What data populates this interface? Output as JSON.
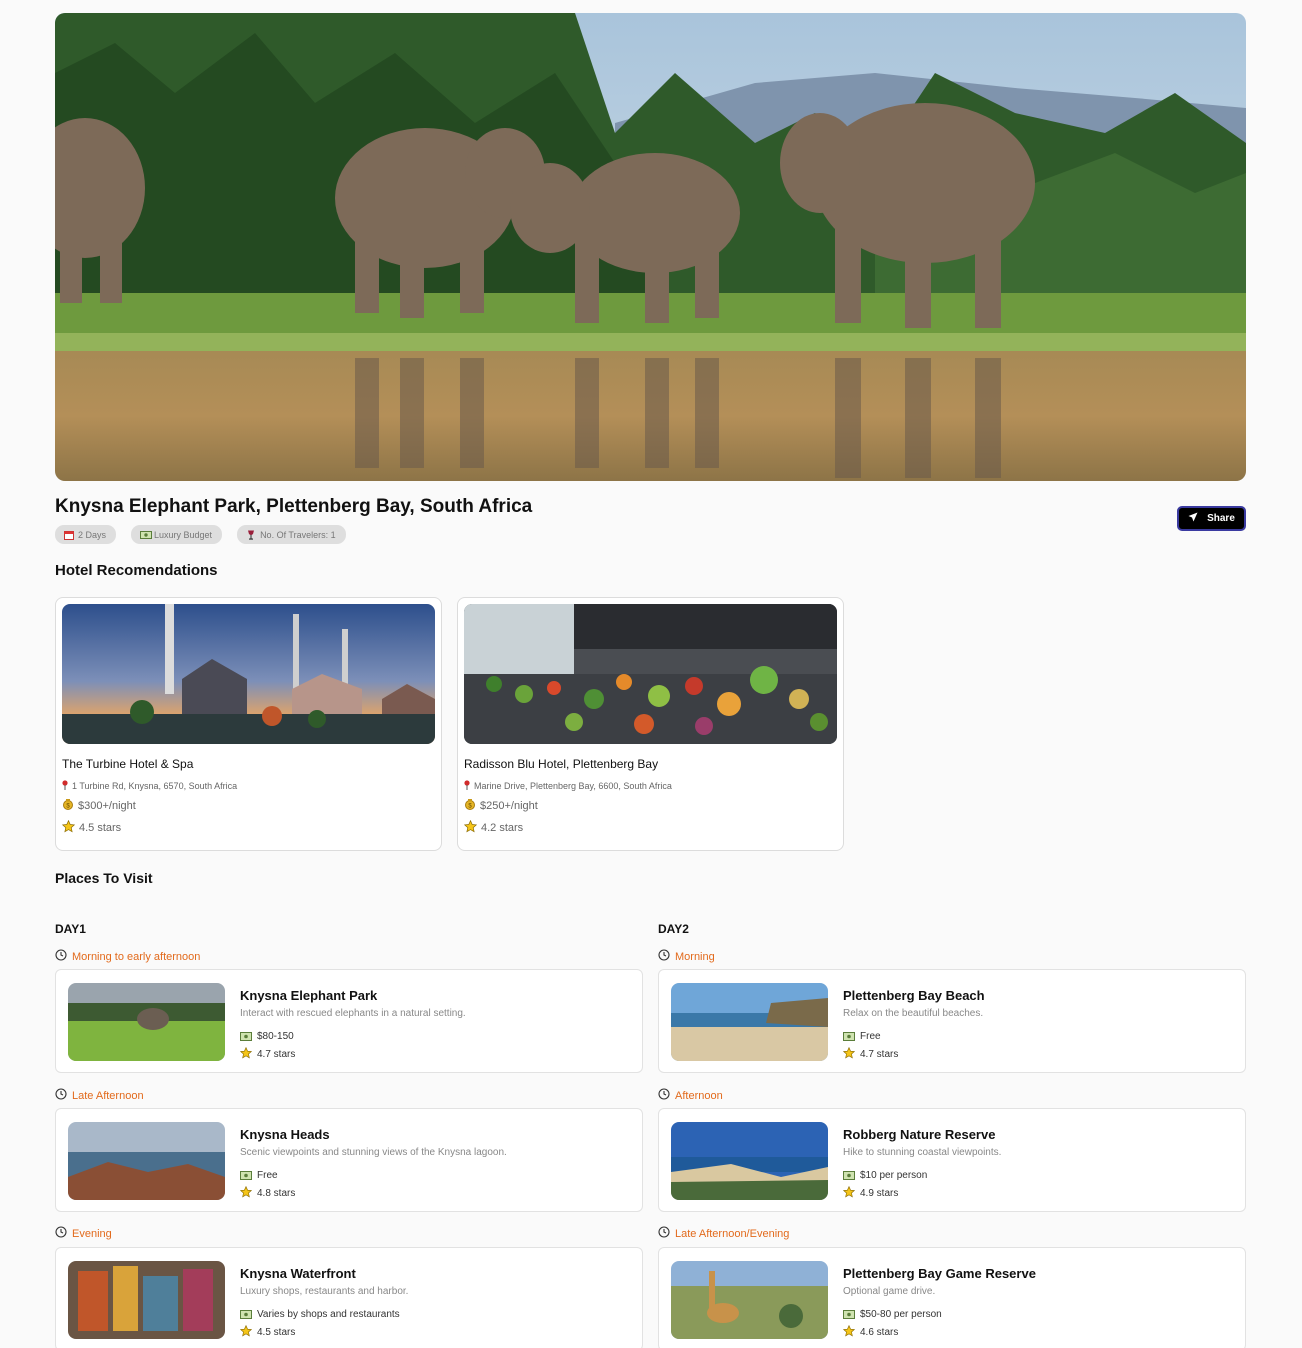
{
  "trip": {
    "title": "Knysna Elephant Park, Plettenberg Bay, South Africa",
    "chips": [
      {
        "icon": "calendar-icon",
        "label": "2 Days"
      },
      {
        "icon": "money-icon",
        "label": "Luxury Budget"
      },
      {
        "icon": "wine-glass-icon",
        "label": "No. Of Travelers: 1"
      }
    ],
    "share_label": "Share"
  },
  "hotels_section": {
    "title": "Hotel Recomendations",
    "hotels": [
      {
        "name": "The Turbine Hotel & Spa",
        "address": "1 Turbine Rd, Knysna, 6570, South Africa",
        "price": "$300+/night",
        "rating": "4.5 stars"
      },
      {
        "name": "Radisson Blu Hotel, Plettenberg Bay",
        "address": "Marine Drive, Plettenberg Bay, 6600, South Africa",
        "price": "$250+/night",
        "rating": "4.2 stars"
      }
    ]
  },
  "places_section": {
    "title": "Places To Visit",
    "days": [
      {
        "label": "DAY1",
        "slots": [
          {
            "time": "Morning to early afternoon",
            "name": "Knysna Elephant Park",
            "desc": "Interact with rescued elephants in a natural setting.",
            "price": "$80-150",
            "rating": "4.7 stars"
          },
          {
            "time": "Late Afternoon",
            "name": "Knysna Heads",
            "desc": "Scenic viewpoints and stunning views of the Knysna lagoon.",
            "price": "Free",
            "rating": "4.8 stars"
          },
          {
            "time": "Evening",
            "name": "Knysna Waterfront",
            "desc": "Luxury shops, restaurants and harbor.",
            "price": "Varies by shops and restaurants",
            "rating": "4.5 stars"
          }
        ]
      },
      {
        "label": "DAY2",
        "slots": [
          {
            "time": "Morning",
            "name": "Plettenberg Bay Beach",
            "desc": "Relax on the beautiful beaches.",
            "price": "Free",
            "rating": "4.7 stars"
          },
          {
            "time": "Afternoon",
            "name": "Robberg Nature Reserve",
            "desc": "Hike to stunning coastal viewpoints.",
            "price": "$10 per person",
            "rating": "4.9 stars"
          },
          {
            "time": "Late Afternoon/Evening",
            "name": "Plettenberg Bay Game Reserve",
            "desc": "Optional game drive.",
            "price": "$50-80 per person",
            "rating": "4.6 stars"
          }
        ]
      }
    ]
  },
  "colors": {
    "accent": "#e26a1c",
    "chip_bg": "#dedede",
    "share_bg": "#000000"
  }
}
